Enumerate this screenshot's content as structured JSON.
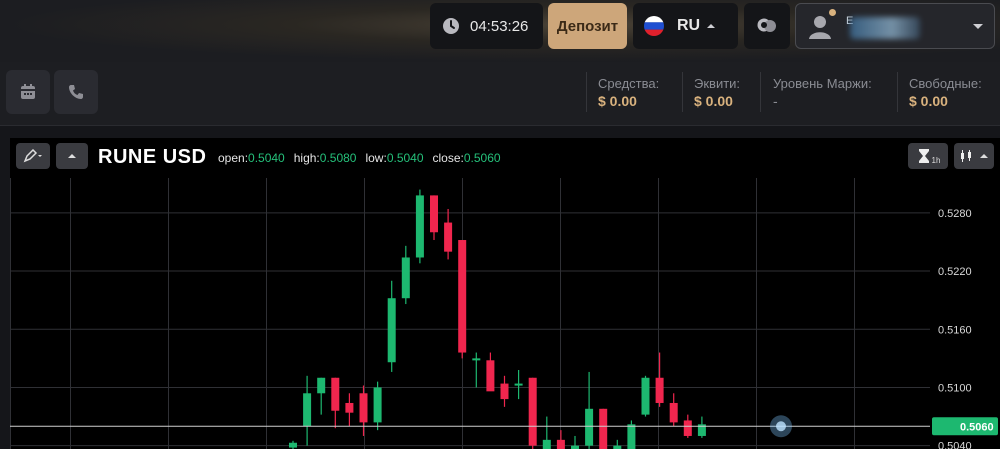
{
  "header": {
    "clock": "04:53:26",
    "deposit_label": "Депозит",
    "language": "RU",
    "user_initial": "E"
  },
  "account": {
    "funds_label": "Средства:",
    "funds_value": "$ 0.00",
    "equity_label": "Эквити:",
    "equity_value": "$ 0.00",
    "margin_label": "Уровень Маржи:",
    "margin_value": "-",
    "free_label": "Свободные:",
    "free_value": "$ 0.00"
  },
  "chart": {
    "symbol": "RUNE USD",
    "open_label": "open:",
    "open_value": "0.5040",
    "high_label": "high:",
    "high_value": "0.5080",
    "low_label": "low:",
    "low_value": "0.5040",
    "close_label": "close:",
    "close_value": "0.5060",
    "timeframe_sub": "1h"
  },
  "colors": {
    "up": "#1db870",
    "down": "#f0264e",
    "accent": "#cda67a"
  },
  "chart_data": {
    "type": "candlestick",
    "ylim": [
      0.5028,
      0.5318
    ],
    "y_ticks": [
      "0.5280",
      "0.5220",
      "0.5160",
      "0.5100",
      "0.5040"
    ],
    "current_price": "0.5060",
    "candles": [
      {
        "o": 0.5038,
        "h": 0.5045,
        "l": 0.502,
        "c": 0.5043
      },
      {
        "o": 0.506,
        "h": 0.5112,
        "l": 0.504,
        "c": 0.5094
      },
      {
        "o": 0.5094,
        "h": 0.511,
        "l": 0.5072,
        "c": 0.511
      },
      {
        "o": 0.511,
        "h": 0.511,
        "l": 0.5058,
        "c": 0.5076
      },
      {
        "o": 0.5084,
        "h": 0.5094,
        "l": 0.506,
        "c": 0.5074
      },
      {
        "o": 0.5094,
        "h": 0.5102,
        "l": 0.505,
        "c": 0.5064
      },
      {
        "o": 0.5064,
        "h": 0.5106,
        "l": 0.5056,
        "c": 0.51
      },
      {
        "o": 0.5126,
        "h": 0.521,
        "l": 0.5116,
        "c": 0.5192
      },
      {
        "o": 0.5192,
        "h": 0.5246,
        "l": 0.5186,
        "c": 0.5234
      },
      {
        "o": 0.5234,
        "h": 0.5304,
        "l": 0.5228,
        "c": 0.5298
      },
      {
        "o": 0.5298,
        "h": 0.5298,
        "l": 0.5252,
        "c": 0.526
      },
      {
        "o": 0.527,
        "h": 0.5284,
        "l": 0.5232,
        "c": 0.524
      },
      {
        "o": 0.5252,
        "h": 0.5252,
        "l": 0.513,
        "c": 0.5136
      },
      {
        "o": 0.513,
        "h": 0.5136,
        "l": 0.51,
        "c": 0.513
      },
      {
        "o": 0.5128,
        "h": 0.5136,
        "l": 0.51,
        "c": 0.5096
      },
      {
        "o": 0.5104,
        "h": 0.5112,
        "l": 0.508,
        "c": 0.5088
      },
      {
        "o": 0.5104,
        "h": 0.5118,
        "l": 0.5088,
        "c": 0.5104
      },
      {
        "o": 0.511,
        "h": 0.511,
        "l": 0.503,
        "c": 0.504
      },
      {
        "o": 0.5034,
        "h": 0.507,
        "l": 0.503,
        "c": 0.5046
      },
      {
        "o": 0.5046,
        "h": 0.5056,
        "l": 0.5026,
        "c": 0.503
      },
      {
        "o": 0.503,
        "h": 0.505,
        "l": 0.5026,
        "c": 0.504
      },
      {
        "o": 0.504,
        "h": 0.5116,
        "l": 0.5036,
        "c": 0.5078
      },
      {
        "o": 0.5078,
        "h": 0.5078,
        "l": 0.503,
        "c": 0.5034
      },
      {
        "o": 0.503,
        "h": 0.5046,
        "l": 0.5026,
        "c": 0.504
      },
      {
        "o": 0.503,
        "h": 0.5066,
        "l": 0.5026,
        "c": 0.5062
      },
      {
        "o": 0.5072,
        "h": 0.5112,
        "l": 0.507,
        "c": 0.511
      },
      {
        "o": 0.511,
        "h": 0.5136,
        "l": 0.508,
        "c": 0.5084
      },
      {
        "o": 0.5084,
        "h": 0.5094,
        "l": 0.506,
        "c": 0.5064
      },
      {
        "o": 0.5066,
        "h": 0.5072,
        "l": 0.5048,
        "c": 0.505
      },
      {
        "o": 0.505,
        "h": 0.507,
        "l": 0.5048,
        "c": 0.5062
      }
    ]
  }
}
